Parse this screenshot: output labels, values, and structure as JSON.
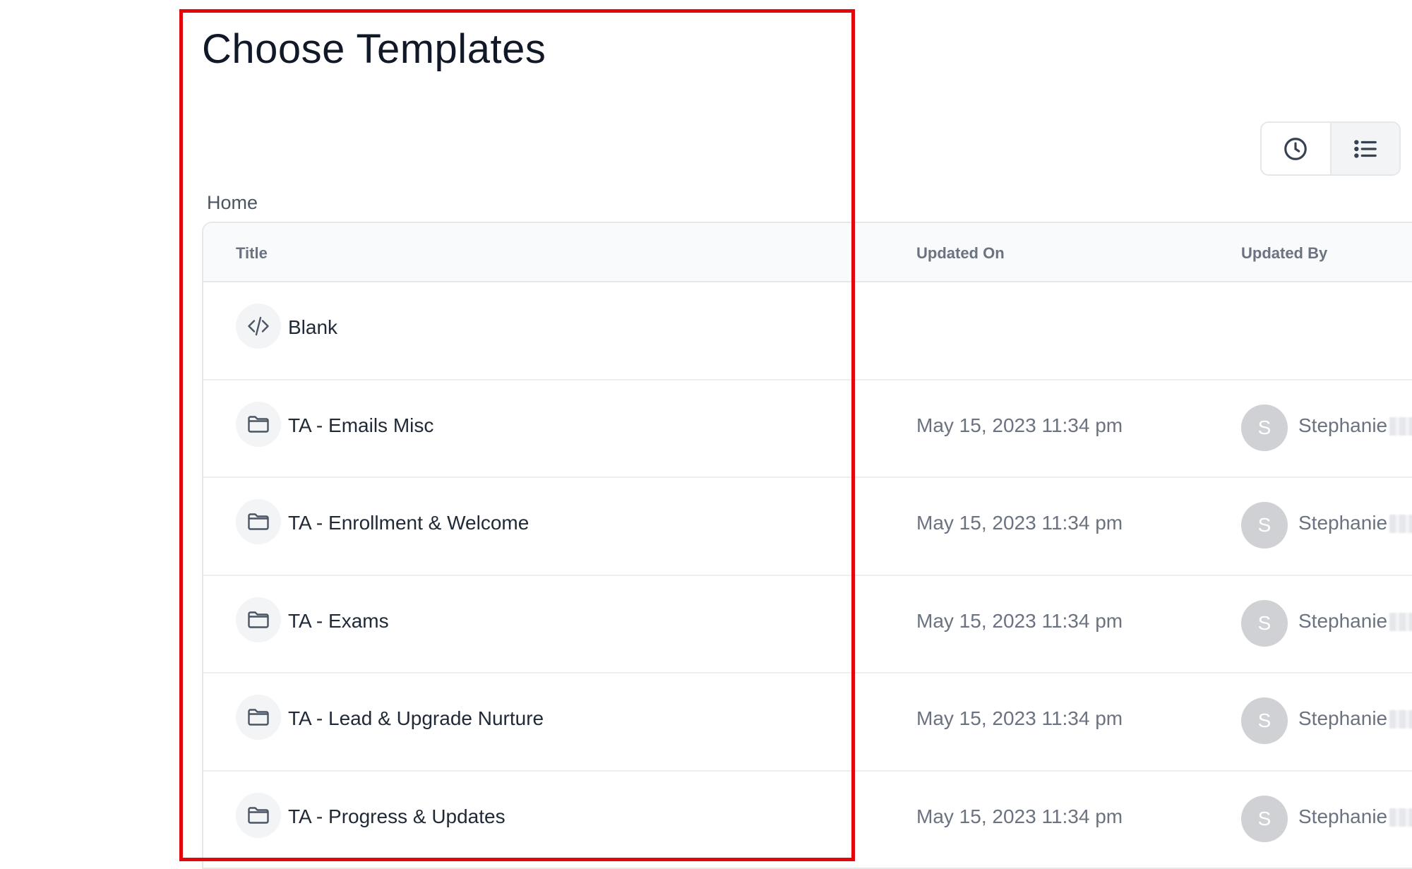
{
  "page": {
    "title": "Choose Templates"
  },
  "toolbar": {
    "recent_icon": "clock-icon",
    "list_icon": "list-icon"
  },
  "breadcrumb": {
    "home": "Home"
  },
  "table": {
    "headers": {
      "title": "Title",
      "updated_on": "Updated On",
      "updated_by": "Updated By"
    },
    "rows": [
      {
        "icon": "code-icon",
        "title": "Blank",
        "updated_on": "",
        "avatar": "",
        "updated_by": ""
      },
      {
        "icon": "folder-icon",
        "title": "TA - Emails Misc",
        "updated_on": "May 15, 2023 11:34 pm",
        "avatar": "S",
        "updated_by": "Stephanie"
      },
      {
        "icon": "folder-icon",
        "title": "TA - Enrollment & Welcome",
        "updated_on": "May 15, 2023 11:34 pm",
        "avatar": "S",
        "updated_by": "Stephanie"
      },
      {
        "icon": "folder-icon",
        "title": "TA - Exams",
        "updated_on": "May 15, 2023 11:34 pm",
        "avatar": "S",
        "updated_by": "Stephanie"
      },
      {
        "icon": "folder-icon",
        "title": "TA - Lead & Upgrade Nurture",
        "updated_on": "May 15, 2023 11:34 pm",
        "avatar": "S",
        "updated_by": "Stephanie"
      },
      {
        "icon": "folder-icon",
        "title": "TA - Progress & Updates",
        "updated_on": "May 15, 2023 11:34 pm",
        "avatar": "S",
        "updated_by": "Stephanie"
      }
    ]
  },
  "colors": {
    "highlight": "#e3060b",
    "border": "#e5e7eb",
    "avatar_bg": "#cfd1d4"
  }
}
